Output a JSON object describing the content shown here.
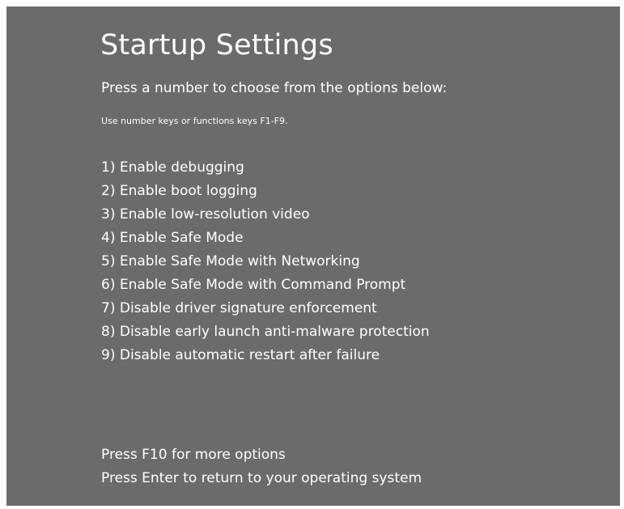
{
  "screen": {
    "title": "Startup Settings",
    "prompt": "Press a number to choose from the options below:",
    "hint": "Use number keys or functions keys F1-F9.",
    "options": [
      "1) Enable debugging",
      "2) Enable boot logging",
      "3) Enable low-resolution video",
      "4) Enable Safe Mode",
      "5) Enable Safe Mode with Networking",
      "6) Enable Safe Mode with Command Prompt",
      "7) Disable driver signature enforcement",
      "8) Disable early launch anti-malware protection",
      "9) Disable automatic restart after failure"
    ],
    "footer": {
      "more_options": "Press F10 for more options",
      "return": "Press Enter to return to your operating system"
    },
    "colors": {
      "background": "#6b6b6b",
      "text": "#ffffff"
    }
  }
}
